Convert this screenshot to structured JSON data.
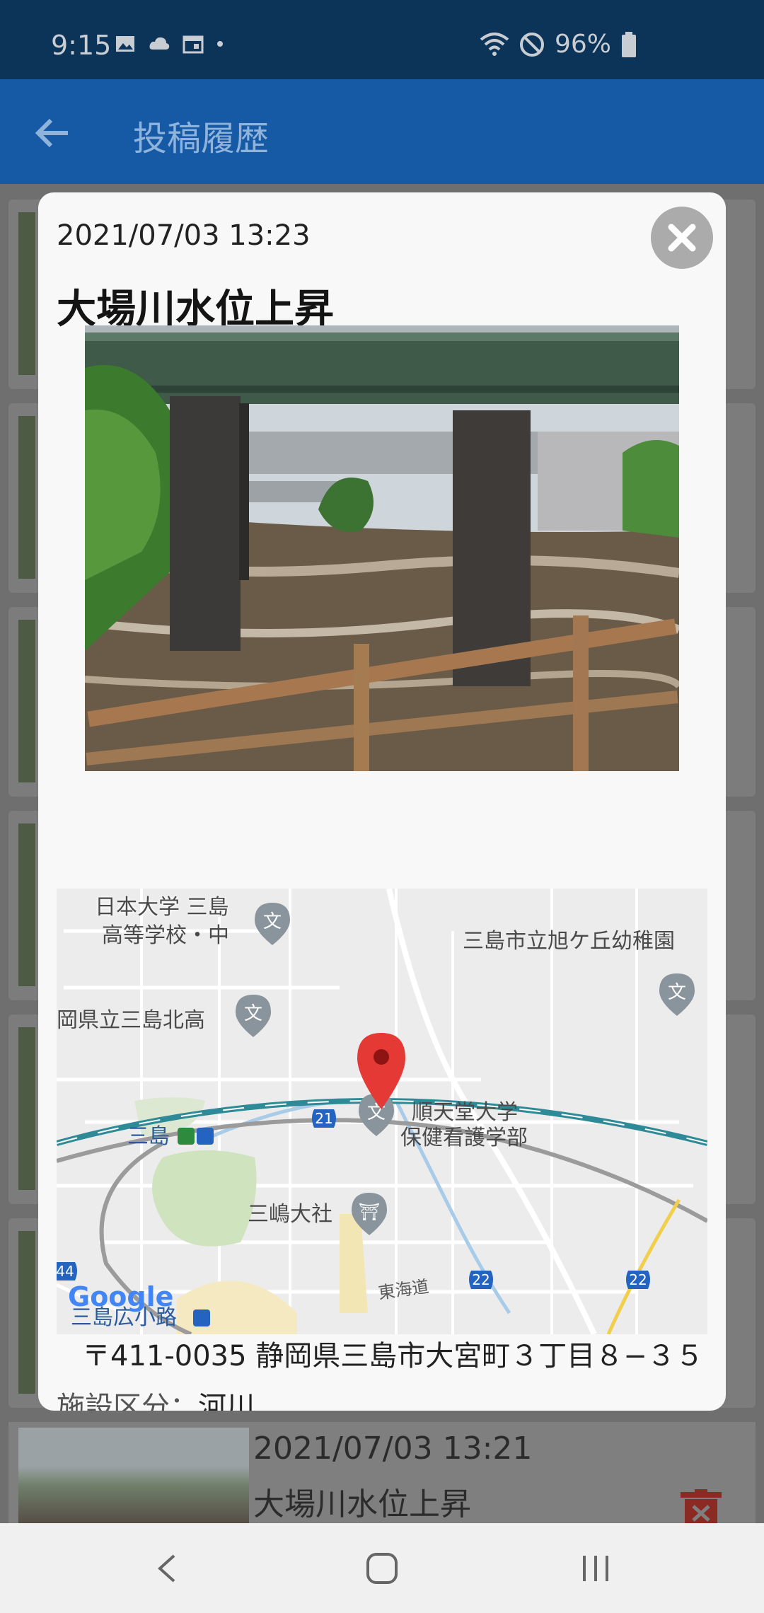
{
  "status_bar": {
    "time": "9:15",
    "battery": "96%"
  },
  "app_bar": {
    "title": "投稿履歴"
  },
  "modal": {
    "date": "2021/07/03 13:23",
    "title": "大場川水位上昇",
    "address": "〒411-0035 静岡県三島市大宮町３丁目８−３５",
    "facility_label": "施設区分：",
    "facility_value": "河川",
    "map": {
      "labels": {
        "school1": "日本大学 三島",
        "school1b": "高等学校・中",
        "kindergarten": "三島市立旭ケ丘幼稚園",
        "north_high": "岡県立三島北高",
        "university": "順天堂大学",
        "university_b": "保健看護学部",
        "station": "三島",
        "shrine": "三嶋大社",
        "tokaido": "東海道",
        "hirokoji": "三島広小路",
        "road21": "21",
        "road22a": "22",
        "road22b": "22",
        "road44": "44",
        "google": "Google"
      }
    }
  },
  "list_bottom": {
    "date": "2021/07/03 13:21",
    "title": "大場川水位上昇"
  },
  "colors": {
    "app_bar": "#165aa6",
    "status_bar": "#0c3358",
    "pin": "#e53935",
    "rail": "#2f8a98"
  },
  "icons": [
    "back-arrow-icon",
    "close-icon",
    "trash-icon",
    "map-pin-icon",
    "school-icon",
    "shrine-icon",
    "nav-back-icon",
    "nav-home-icon",
    "nav-recents-icon"
  ]
}
